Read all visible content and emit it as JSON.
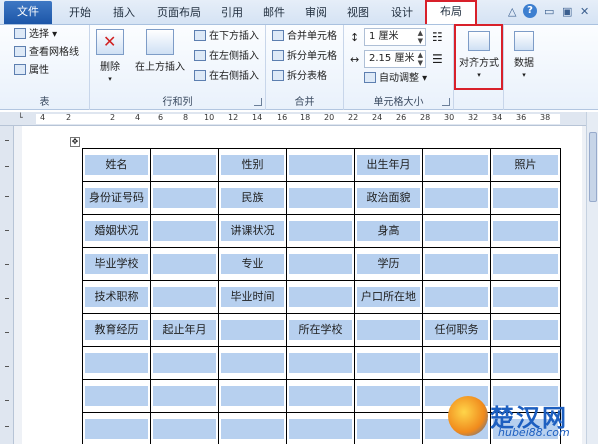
{
  "tabs": [
    "文件",
    "开始",
    "插入",
    "页面布局",
    "引用",
    "邮件",
    "审阅",
    "视图",
    "设计",
    "布局"
  ],
  "window_controls": {
    "collapse": "△",
    "help": "?",
    "minimize": "▭",
    "restore": "▣",
    "close": "✕"
  },
  "ribbon": {
    "table_group": {
      "label": "表",
      "select": "选择 ▾",
      "gridlines": "查看网格线",
      "properties": "属性"
    },
    "rows_cols_group": {
      "label": "行和列",
      "delete": "删除",
      "insert_above": "在上方插入",
      "insert_below": "在下方插入",
      "insert_left": "在左侧插入",
      "insert_right": "在右侧插入"
    },
    "merge_group": {
      "label": "合并",
      "merge_cells": "合并单元格",
      "split_cells": "拆分单元格",
      "split_table": "拆分表格"
    },
    "cell_size_group": {
      "label": "单元格大小",
      "height": "1 厘米",
      "width": "2.15 厘米",
      "autofit": "自动调整 ▾"
    },
    "alignment": {
      "label": "对齐方式"
    },
    "data": {
      "label": "数据"
    }
  },
  "ruler_numbers": [
    "4",
    "2",
    "2",
    "4",
    "6",
    "8",
    "10",
    "12",
    "14",
    "16",
    "18",
    "20",
    "22",
    "24",
    "26",
    "28",
    "30",
    "32",
    "34",
    "36",
    "38"
  ],
  "form": {
    "rows": [
      [
        "姓名",
        "",
        "性别",
        "",
        "出生年月",
        "",
        "照片"
      ],
      [
        "身份证号码",
        "",
        "民族",
        "",
        "政治面貌",
        "",
        ""
      ],
      [
        "婚姻状况",
        "",
        "讲课状况",
        "",
        "身高",
        "",
        ""
      ],
      [
        "毕业学校",
        "",
        "专业",
        "",
        "学历",
        "",
        ""
      ],
      [
        "技术职称",
        "",
        "毕业时间",
        "",
        "户口所在地",
        "",
        ""
      ],
      [
        "教育经历",
        "起止年月",
        "",
        "所在学校",
        "",
        "任何职务",
        ""
      ],
      [
        "",
        "",
        "",
        "",
        "",
        "",
        ""
      ],
      [
        "",
        "",
        "",
        "",
        "",
        "",
        ""
      ],
      [
        "",
        "",
        "",
        "",
        "",
        "",
        ""
      ]
    ]
  },
  "watermark": {
    "name": "楚汉网",
    "url": "hubei88.com"
  }
}
